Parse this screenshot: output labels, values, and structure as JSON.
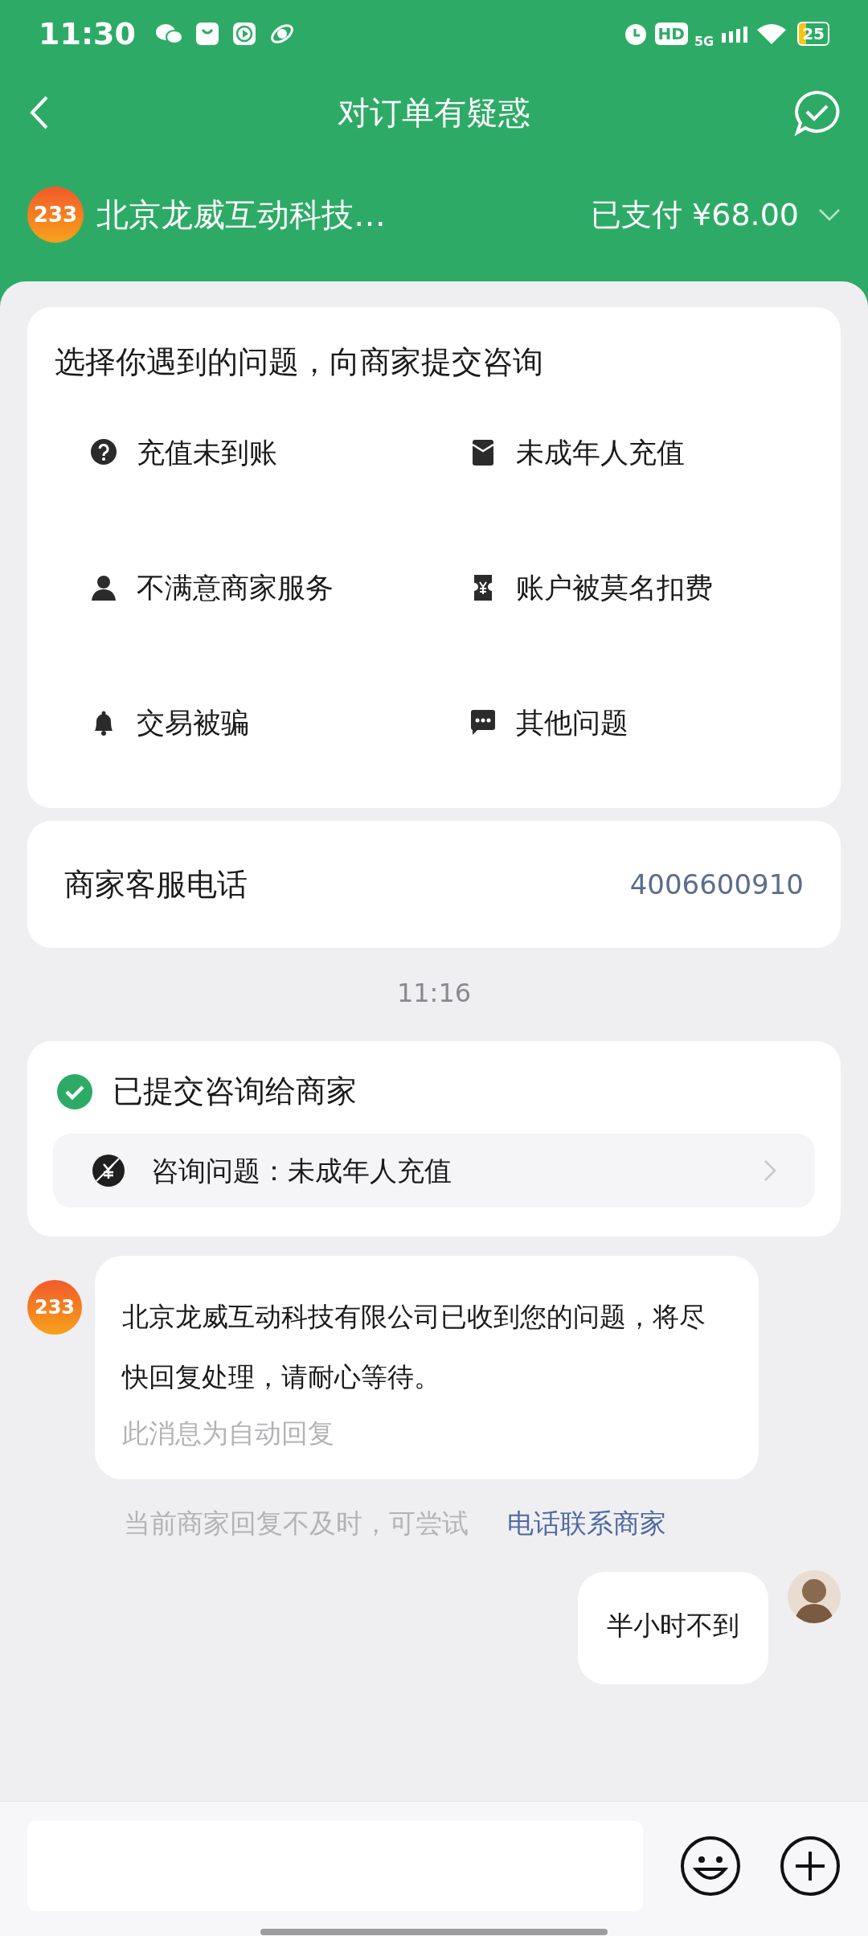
{
  "status_bar": {
    "time": "11:30",
    "hd_label": "HD",
    "network": "5G",
    "battery": "25"
  },
  "header": {
    "title": "对订单有疑惑"
  },
  "merchant": {
    "logo_text": "233",
    "name": "北京龙威互动科技…",
    "payment": "已支付 ¥68.00"
  },
  "issues": {
    "title": "选择你遇到的问题，向商家提交咨询",
    "options": [
      {
        "kind": "question",
        "label": "充值未到账"
      },
      {
        "kind": "envelope",
        "label": "未成年人充值"
      },
      {
        "kind": "person",
        "label": "不满意商家服务"
      },
      {
        "kind": "ticket",
        "label": "账户被莫名扣费"
      },
      {
        "kind": "bell",
        "label": "交易被骗"
      },
      {
        "kind": "chat",
        "label": "其他问题"
      }
    ]
  },
  "phone": {
    "label": "商家客服电话",
    "number": "4006600910"
  },
  "messages": [
    {
      "kind": "time",
      "text": "11:16"
    },
    {
      "kind": "submitted",
      "title": "已提交咨询给商家",
      "detail": "咨询问题：未成年人充值"
    },
    {
      "kind": "merchant",
      "avatar_text": "233",
      "text": "北京龙威互动科技有限公司已收到您的问题，将尽快回复处理，请耐心等待。",
      "note": "此消息为自动回复"
    },
    {
      "kind": "hint",
      "text": "当前商家回复不及时，可尝试",
      "link": "电话联系商家"
    },
    {
      "kind": "user",
      "text": "半小时不到"
    }
  ]
}
